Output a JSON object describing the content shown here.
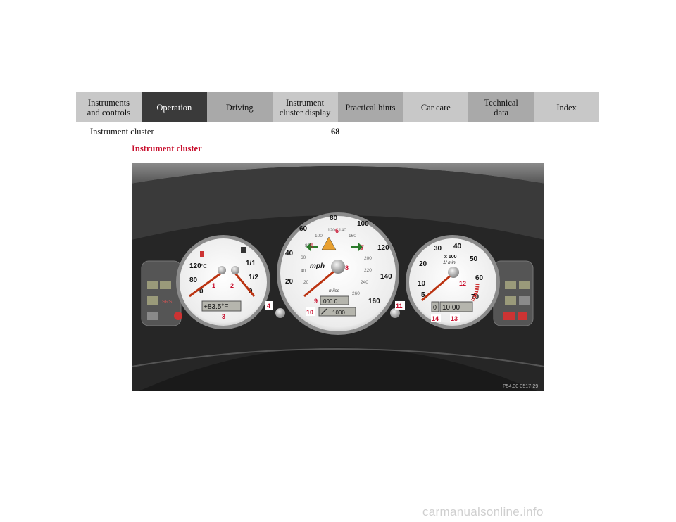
{
  "nav": {
    "tabs": [
      {
        "label": "Instruments\nand controls"
      },
      {
        "label": "Operation"
      },
      {
        "label": "Driving"
      },
      {
        "label": "Instrument\ncluster display"
      },
      {
        "label": "Practical hints"
      },
      {
        "label": "Car care"
      },
      {
        "label": "Technical\ndata"
      },
      {
        "label": "Index"
      }
    ]
  },
  "header": {
    "title": "Instrument cluster",
    "page_number": "68"
  },
  "section": {
    "heading": "Instrument cluster"
  },
  "figure": {
    "code": "P54.30-3517-29",
    "callouts": [
      "1",
      "2",
      "3",
      "4",
      "5",
      "6",
      "7",
      "8",
      "9",
      "10",
      "11",
      "12",
      "13",
      "14"
    ],
    "temp_gauge": {
      "ticks": [
        "120",
        "80",
        "0"
      ],
      "unit": "°C",
      "display": "+83.5°F"
    },
    "fuel_gauge": {
      "ticks": [
        "1/1",
        "1/2",
        "0"
      ]
    },
    "speedometer": {
      "outer": [
        "20",
        "40",
        "60",
        "80",
        "100",
        "120",
        "140",
        "160"
      ],
      "inner": [
        "20",
        "40",
        "60",
        "80",
        "100",
        "120",
        "140",
        "160",
        "200",
        "220",
        "240",
        "260"
      ],
      "unit": "mph",
      "odo_label": "miles",
      "trip": "000.0",
      "odometer": "1000"
    },
    "tachometer": {
      "ticks": [
        "5",
        "10",
        "20",
        "30",
        "40",
        "50",
        "60",
        "70"
      ],
      "unit1": "x 100",
      "unit2": "1/ min",
      "gear": "0",
      "clock": "10:00"
    },
    "left_panel": {
      "srs": "SRS"
    }
  },
  "watermark": "carmanualsonline.info"
}
